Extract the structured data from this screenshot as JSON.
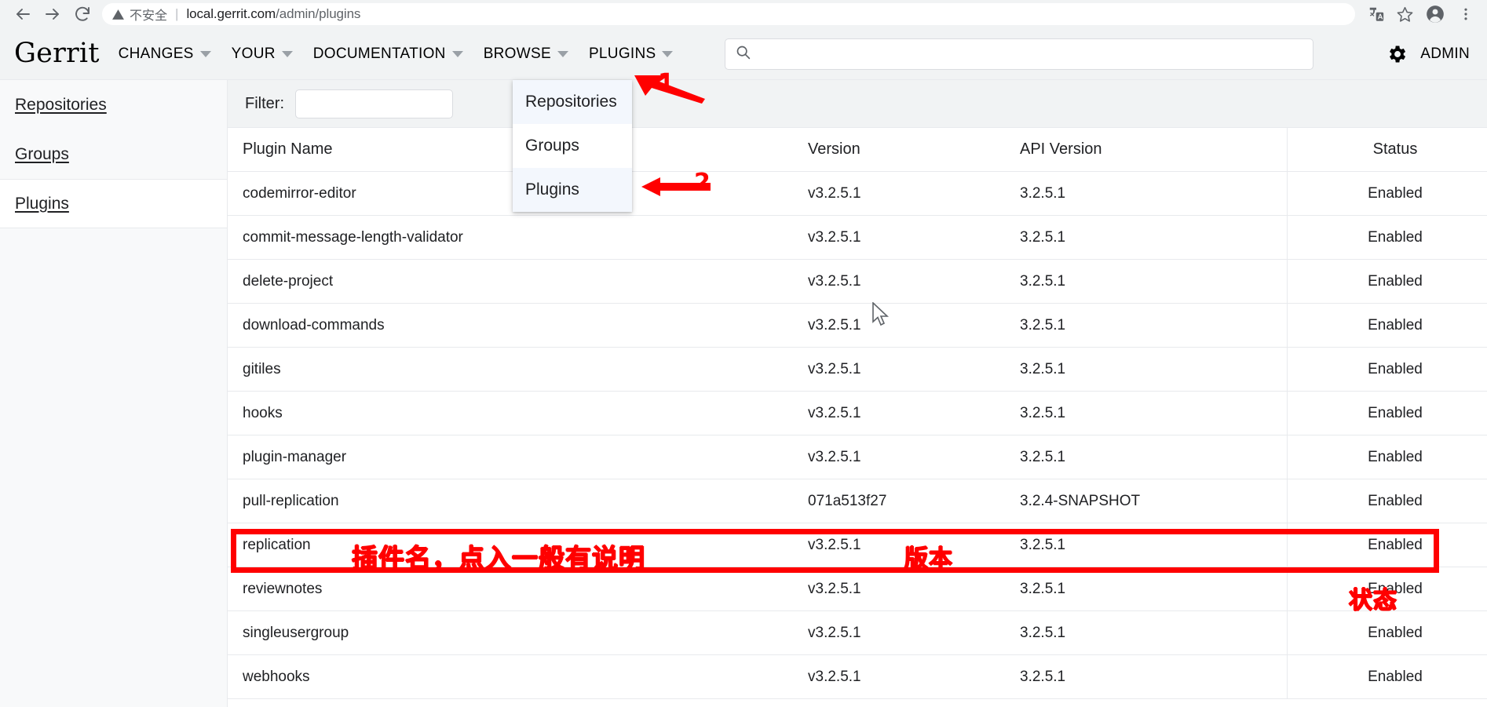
{
  "browser": {
    "back_icon": "arrow-left-icon",
    "forward_icon": "arrow-right-icon",
    "reload_icon": "reload-icon",
    "security_icon": "warning-triangle-icon",
    "security_label": "不安全",
    "url_domain": "local.gerrit.com",
    "url_path": "/admin/plugins",
    "url_full": "local.gerrit.com/admin/plugins",
    "translate_icon": "translate-icon",
    "bookmark_icon": "star-icon",
    "profile_icon": "account-circle-icon",
    "menu_icon": "three-dots-vertical-icon"
  },
  "header": {
    "brand": "Gerrit",
    "nav": [
      {
        "label": "CHANGES",
        "has_caret": true
      },
      {
        "label": "YOUR",
        "has_caret": true
      },
      {
        "label": "DOCUMENTATION",
        "has_caret": true
      },
      {
        "label": "BROWSE",
        "has_caret": true
      },
      {
        "label": "PLUGINS",
        "has_caret": true
      }
    ],
    "search": {
      "value": "",
      "placeholder": "",
      "icon": "search-icon"
    },
    "settings_icon": "gear-icon",
    "account_label": "ADMIN"
  },
  "dropdown": {
    "open_for": "BROWSE",
    "items": [
      {
        "label": "Repositories",
        "highlighted": true
      },
      {
        "label": "Groups",
        "highlighted": false
      },
      {
        "label": "Plugins",
        "highlighted": true
      }
    ]
  },
  "sidebar": {
    "items": [
      {
        "label": "Repositories",
        "selected": false
      },
      {
        "label": "Groups",
        "selected": false
      },
      {
        "label": "Plugins",
        "selected": true
      }
    ]
  },
  "filter": {
    "label": "Filter:",
    "value": "",
    "placeholder": ""
  },
  "table": {
    "columns": [
      "Plugin Name",
      "Version",
      "API Version",
      "Status"
    ],
    "rows": [
      {
        "name": "codemirror-editor",
        "version": "v3.2.5.1",
        "api_version": "3.2.5.1",
        "status": "Enabled"
      },
      {
        "name": "commit-message-length-validator",
        "version": "v3.2.5.1",
        "api_version": "3.2.5.1",
        "status": "Enabled"
      },
      {
        "name": "delete-project",
        "version": "v3.2.5.1",
        "api_version": "3.2.5.1",
        "status": "Enabled"
      },
      {
        "name": "download-commands",
        "version": "v3.2.5.1",
        "api_version": "3.2.5.1",
        "status": "Enabled"
      },
      {
        "name": "gitiles",
        "version": "v3.2.5.1",
        "api_version": "3.2.5.1",
        "status": "Enabled"
      },
      {
        "name": "hooks",
        "version": "v3.2.5.1",
        "api_version": "3.2.5.1",
        "status": "Enabled"
      },
      {
        "name": "plugin-manager",
        "version": "v3.2.5.1",
        "api_version": "3.2.5.1",
        "status": "Enabled"
      },
      {
        "name": "pull-replication",
        "version": "071a513f27",
        "api_version": "3.2.4-SNAPSHOT",
        "status": "Enabled"
      },
      {
        "name": "replication",
        "version": "v3.2.5.1",
        "api_version": "3.2.5.1",
        "status": "Enabled"
      },
      {
        "name": "reviewnotes",
        "version": "v3.2.5.1",
        "api_version": "3.2.5.1",
        "status": "Enabled"
      },
      {
        "name": "singleusergroup",
        "version": "v3.2.5.1",
        "api_version": "3.2.5.1",
        "status": "Enabled"
      },
      {
        "name": "webhooks",
        "version": "v3.2.5.1",
        "api_version": "3.2.5.1",
        "status": "Enabled"
      }
    ]
  },
  "annotations": {
    "color": "#ff0000",
    "marker_1": "1",
    "marker_2": "2",
    "plugin_name_note": "插件名，点入一般有说明",
    "version_note": "版本",
    "status_note": "状态"
  }
}
